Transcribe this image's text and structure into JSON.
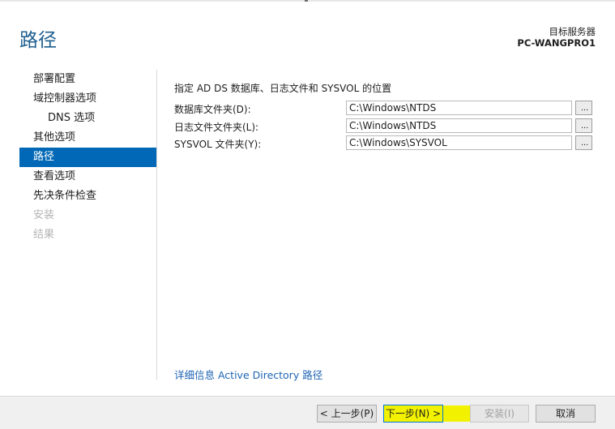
{
  "header": {
    "title": "路径",
    "server_label": "目标服务器",
    "server_name": "PC-WANGPRO1"
  },
  "sidebar": {
    "items": [
      {
        "label": "部署配置",
        "state": "normal"
      },
      {
        "label": "域控制器选项",
        "state": "normal"
      },
      {
        "label": "DNS 选项",
        "state": "sub"
      },
      {
        "label": "其他选项",
        "state": "normal"
      },
      {
        "label": "路径",
        "state": "active"
      },
      {
        "label": "查看选项",
        "state": "normal"
      },
      {
        "label": "先决条件检查",
        "state": "normal"
      },
      {
        "label": "安装",
        "state": "disabled"
      },
      {
        "label": "结果",
        "state": "disabled"
      }
    ]
  },
  "main": {
    "heading": "指定 AD DS 数据库、日志文件和 SYSVOL 的位置",
    "fields": [
      {
        "label": "数据库文件夹(D):",
        "value": "C:\\Windows\\NTDS",
        "browse": "..."
      },
      {
        "label": "日志文件文件夹(L):",
        "value": "C:\\Windows\\NTDS",
        "browse": "..."
      },
      {
        "label": "SYSVOL 文件夹(Y):",
        "value": "C:\\Windows\\SYSVOL",
        "browse": "..."
      }
    ],
    "more_link": "详细信息 Active Directory 路径"
  },
  "footer": {
    "prev_label": "< 上一步(P)",
    "next_label": "下一步(N) >",
    "install_label": "安装(I)",
    "cancel_label": "取消"
  },
  "colors": {
    "title": "#1f5f8f",
    "active_nav": "#0068b6",
    "link": "#1e64b4",
    "highlight": "#f2f200"
  }
}
